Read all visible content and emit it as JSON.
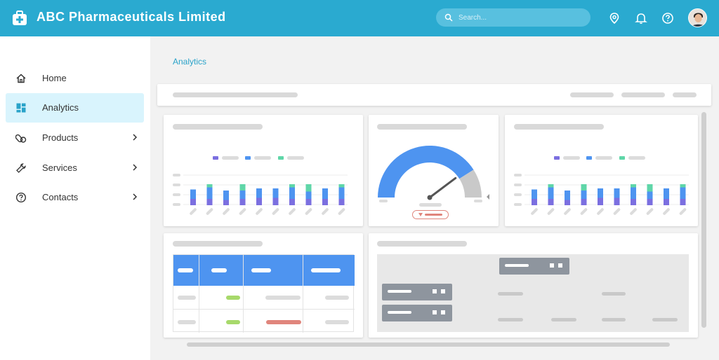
{
  "app": {
    "title": "ABC Pharmaceuticals Limited",
    "brand_color": "#2aaad0"
  },
  "search": {
    "placeholder": "Search..."
  },
  "toolbar_icons": [
    "location-pin-icon",
    "bell-icon",
    "help-icon"
  ],
  "sidebar": {
    "items": [
      {
        "label": "Home",
        "icon": "home-icon",
        "has_submenu": false,
        "active": false
      },
      {
        "label": "Analytics",
        "icon": "dashboard-icon",
        "has_submenu": false,
        "active": true
      },
      {
        "label": "Products",
        "icon": "pills-icon",
        "has_submenu": true,
        "active": false
      },
      {
        "label": "Services",
        "icon": "wrench-icon",
        "has_submenu": true,
        "active": false
      },
      {
        "label": "Contacts",
        "icon": "question-icon",
        "has_submenu": true,
        "active": false
      }
    ],
    "active_bg": "#d9f4fd"
  },
  "main": {
    "title": "Analytics"
  },
  "chart_data": [
    {
      "type": "bar",
      "stacked": true,
      "series_colors": [
        "#7b6fe0",
        "#4e94f0",
        "#5fd6a8"
      ],
      "values": [
        [
          0.3,
          0.45,
          0.0
        ],
        [
          0.3,
          0.55,
          0.15
        ],
        [
          0.25,
          0.45,
          0.0
        ],
        [
          0.3,
          0.4,
          0.3
        ],
        [
          0.35,
          0.45,
          0.0
        ],
        [
          0.35,
          0.45,
          0.0
        ],
        [
          0.3,
          0.55,
          0.15
        ],
        [
          0.3,
          0.35,
          0.35
        ],
        [
          0.3,
          0.5,
          0.0
        ],
        [
          0.3,
          0.55,
          0.15
        ]
      ]
    },
    {
      "type": "gauge",
      "value_fraction": 0.82,
      "fill_color": "#4e94f0",
      "rest_color": "#c9c9c9"
    },
    {
      "type": "bar",
      "stacked": true,
      "series_colors": [
        "#7b6fe0",
        "#4e94f0",
        "#5fd6a8"
      ],
      "values": [
        [
          0.3,
          0.45,
          0.0
        ],
        [
          0.3,
          0.55,
          0.15
        ],
        [
          0.25,
          0.45,
          0.0
        ],
        [
          0.3,
          0.4,
          0.3
        ],
        [
          0.35,
          0.45,
          0.0
        ],
        [
          0.35,
          0.45,
          0.0
        ],
        [
          0.3,
          0.55,
          0.15
        ],
        [
          0.3,
          0.35,
          0.35
        ],
        [
          0.3,
          0.5,
          0.0
        ],
        [
          0.3,
          0.55,
          0.15
        ]
      ]
    }
  ],
  "table": {
    "header_color": "#4e94f0",
    "status_colors": [
      "#a7d96b",
      "#e0857c"
    ]
  }
}
